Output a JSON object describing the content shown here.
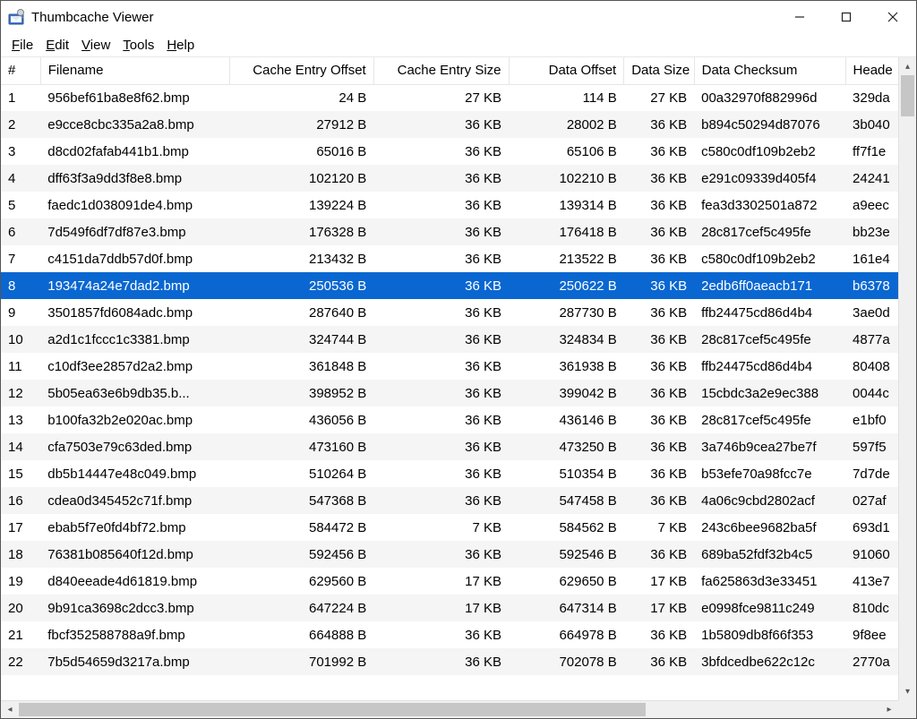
{
  "window": {
    "title": "Thumbcache Viewer"
  },
  "menu": {
    "file": {
      "underline": "F",
      "rest": "ile"
    },
    "edit": {
      "underline": "E",
      "rest": "dit"
    },
    "view": {
      "underline": "V",
      "rest": "iew"
    },
    "tools": {
      "underline": "T",
      "rest": "ools"
    },
    "help": {
      "underline": "H",
      "rest": "elp"
    }
  },
  "columns": {
    "num": "#",
    "filename": "Filename",
    "cache_entry_offset": "Cache Entry Offset",
    "cache_entry_size": "Cache Entry Size",
    "data_offset": "Data Offset",
    "data_size": "Data Size",
    "data_checksum": "Data Checksum",
    "header_checksum": "Heade"
  },
  "selected_index": 7,
  "rows": [
    {
      "n": "1",
      "fn": "956bef61ba8e8f62.bmp",
      "ceo": "24 B",
      "ces": "27 KB",
      "do": "114 B",
      "ds": "27 KB",
      "dc": "00a32970f882996d",
      "hc": "329da"
    },
    {
      "n": "2",
      "fn": "e9cce8cbc335a2a8.bmp",
      "ceo": "27912 B",
      "ces": "36 KB",
      "do": "28002 B",
      "ds": "36 KB",
      "dc": "b894c50294d87076",
      "hc": "3b040"
    },
    {
      "n": "3",
      "fn": "d8cd02fafab441b1.bmp",
      "ceo": "65016 B",
      "ces": "36 KB",
      "do": "65106 B",
      "ds": "36 KB",
      "dc": "c580c0df109b2eb2",
      "hc": "ff7f1e"
    },
    {
      "n": "4",
      "fn": "dff63f3a9dd3f8e8.bmp",
      "ceo": "102120 B",
      "ces": "36 KB",
      "do": "102210 B",
      "ds": "36 KB",
      "dc": "e291c09339d405f4",
      "hc": "24241"
    },
    {
      "n": "5",
      "fn": "faedc1d038091de4.bmp",
      "ceo": "139224 B",
      "ces": "36 KB",
      "do": "139314 B",
      "ds": "36 KB",
      "dc": "fea3d3302501a872",
      "hc": "a9eec"
    },
    {
      "n": "6",
      "fn": "7d549f6df7df87e3.bmp",
      "ceo": "176328 B",
      "ces": "36 KB",
      "do": "176418 B",
      "ds": "36 KB",
      "dc": "28c817cef5c495fe",
      "hc": "bb23e"
    },
    {
      "n": "7",
      "fn": "c4151da7ddb57d0f.bmp",
      "ceo": "213432 B",
      "ces": "36 KB",
      "do": "213522 B",
      "ds": "36 KB",
      "dc": "c580c0df109b2eb2",
      "hc": "161e4"
    },
    {
      "n": "8",
      "fn": "193474a24e7dad2.bmp",
      "ceo": "250536 B",
      "ces": "36 KB",
      "do": "250622 B",
      "ds": "36 KB",
      "dc": "2edb6ff0aeacb171",
      "hc": "b6378"
    },
    {
      "n": "9",
      "fn": "3501857fd6084adc.bmp",
      "ceo": "287640 B",
      "ces": "36 KB",
      "do": "287730 B",
      "ds": "36 KB",
      "dc": "ffb24475cd86d4b4",
      "hc": "3ae0d"
    },
    {
      "n": "10",
      "fn": "a2d1c1fccc1c3381.bmp",
      "ceo": "324744 B",
      "ces": "36 KB",
      "do": "324834 B",
      "ds": "36 KB",
      "dc": "28c817cef5c495fe",
      "hc": "4877a"
    },
    {
      "n": "11",
      "fn": "c10df3ee2857d2a2.bmp",
      "ceo": "361848 B",
      "ces": "36 KB",
      "do": "361938 B",
      "ds": "36 KB",
      "dc": "ffb24475cd86d4b4",
      "hc": "80408"
    },
    {
      "n": "12",
      "fn": "5b05ea63e6b9db35.b...",
      "ceo": "398952 B",
      "ces": "36 KB",
      "do": "399042 B",
      "ds": "36 KB",
      "dc": "15cbdc3a2e9ec388",
      "hc": "0044c"
    },
    {
      "n": "13",
      "fn": "b100fa32b2e020ac.bmp",
      "ceo": "436056 B",
      "ces": "36 KB",
      "do": "436146 B",
      "ds": "36 KB",
      "dc": "28c817cef5c495fe",
      "hc": "e1bf0"
    },
    {
      "n": "14",
      "fn": "cfa7503e79c63ded.bmp",
      "ceo": "473160 B",
      "ces": "36 KB",
      "do": "473250 B",
      "ds": "36 KB",
      "dc": "3a746b9cea27be7f",
      "hc": "597f5"
    },
    {
      "n": "15",
      "fn": "db5b14447e48c049.bmp",
      "ceo": "510264 B",
      "ces": "36 KB",
      "do": "510354 B",
      "ds": "36 KB",
      "dc": "b53efe70a98fcc7e",
      "hc": "7d7de"
    },
    {
      "n": "16",
      "fn": "cdea0d345452c71f.bmp",
      "ceo": "547368 B",
      "ces": "36 KB",
      "do": "547458 B",
      "ds": "36 KB",
      "dc": "4a06c9cbd2802acf",
      "hc": "027af"
    },
    {
      "n": "17",
      "fn": "ebab5f7e0fd4bf72.bmp",
      "ceo": "584472 B",
      "ces": "7 KB",
      "do": "584562 B",
      "ds": "7 KB",
      "dc": "243c6bee9682ba5f",
      "hc": "693d1"
    },
    {
      "n": "18",
      "fn": "76381b085640f12d.bmp",
      "ceo": "592456 B",
      "ces": "36 KB",
      "do": "592546 B",
      "ds": "36 KB",
      "dc": "689ba52fdf32b4c5",
      "hc": "91060"
    },
    {
      "n": "19",
      "fn": "d840eeade4d61819.bmp",
      "ceo": "629560 B",
      "ces": "17 KB",
      "do": "629650 B",
      "ds": "17 KB",
      "dc": "fa625863d3e33451",
      "hc": "413e7"
    },
    {
      "n": "20",
      "fn": "9b91ca3698c2dcc3.bmp",
      "ceo": "647224 B",
      "ces": "17 KB",
      "do": "647314 B",
      "ds": "17 KB",
      "dc": "e0998fce9811c249",
      "hc": "810dc"
    },
    {
      "n": "21",
      "fn": "fbcf352588788a9f.bmp",
      "ceo": "664888 B",
      "ces": "36 KB",
      "do": "664978 B",
      "ds": "36 KB",
      "dc": "1b5809db8f66f353",
      "hc": "9f8ee"
    },
    {
      "n": "22",
      "fn": "7b5d54659d3217a.bmp",
      "ceo": "701992 B",
      "ces": "36 KB",
      "do": "702078 B",
      "ds": "36 KB",
      "dc": "3bfdcedbe622c12c",
      "hc": "2770a"
    }
  ]
}
